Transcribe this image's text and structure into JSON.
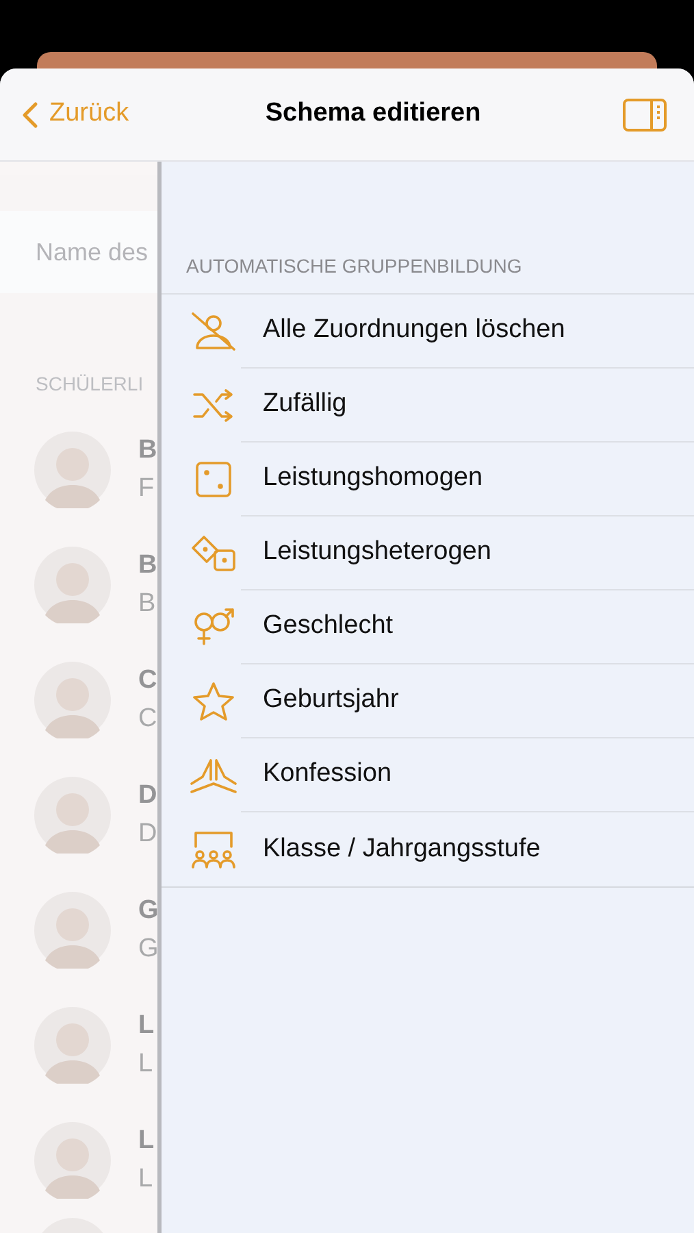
{
  "nav": {
    "back": "Zurück",
    "title": "Schema editieren"
  },
  "left": {
    "search": {
      "placeholder": "Name des"
    },
    "section": "SCHÜLERLI",
    "students": [
      {
        "name": "B",
        "sub": "F"
      },
      {
        "name": "B",
        "sub": "B"
      },
      {
        "name": "C",
        "sub": "C"
      },
      {
        "name": "D",
        "sub": "D"
      },
      {
        "name": "G",
        "sub": "G"
      },
      {
        "name": "L",
        "sub": "L"
      },
      {
        "name": "L",
        "sub": "L"
      }
    ]
  },
  "menu": {
    "header": "AUTOMATISCHE GRUPPENBILDUNG",
    "items": [
      "Alle Zuordnungen löschen",
      "Zufällig",
      "Leistungshomogen",
      "Leistungsheterogen",
      "Geschlecht",
      "Geburtsjahr",
      "Konfession",
      "Klasse / Jahrgangsstufe"
    ]
  }
}
